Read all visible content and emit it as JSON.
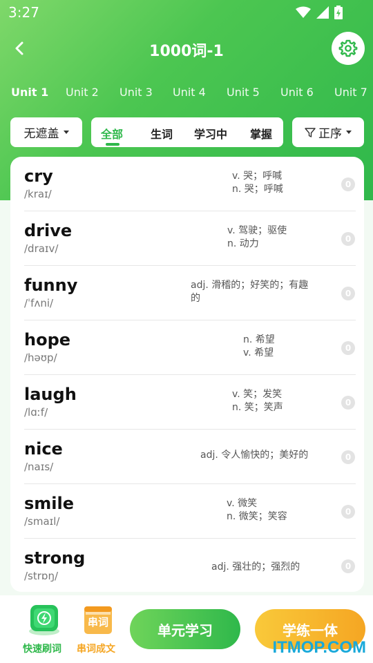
{
  "status": {
    "time": "3:27"
  },
  "header": {
    "title": "1000词-1"
  },
  "units": [
    "Unit 1",
    "Unit 2",
    "Unit 3",
    "Unit 4",
    "Unit 5",
    "Unit 6",
    "Unit 7"
  ],
  "filters": {
    "cover_label": "无遮盖",
    "tabs": [
      "全部",
      "生词",
      "学习中",
      "掌握"
    ],
    "order_label": "正序"
  },
  "words": [
    {
      "word": "cry",
      "phonetic": "/kraɪ/",
      "meaning_1": "v. 哭；呼喊",
      "meaning_2": "n. 哭；呼喊",
      "count": "0"
    },
    {
      "word": "drive",
      "phonetic": "/draɪv/",
      "meaning_1": "v. 驾驶；驱使",
      "meaning_2": "n. 动力",
      "count": "0"
    },
    {
      "word": "funny",
      "phonetic": "/ˈfʌni/",
      "meaning_1": "adj. 滑稽的；好笑的；有趣",
      "meaning_2": "的",
      "count": "0"
    },
    {
      "word": "hope",
      "phonetic": "/həʊp/",
      "meaning_1": "n. 希望",
      "meaning_2": "v. 希望",
      "count": "0"
    },
    {
      "word": "laugh",
      "phonetic": "/lɑːf/",
      "meaning_1": "v. 笑；发笑",
      "meaning_2": "n. 笑；笑声",
      "count": "0"
    },
    {
      "word": "nice",
      "phonetic": "/naɪs/",
      "meaning_1": "adj. 令人愉快的；美好的",
      "meaning_2": "",
      "count": "0"
    },
    {
      "word": "smile",
      "phonetic": "/smaɪl/",
      "meaning_1": "v. 微笑",
      "meaning_2": "n. 微笑；笑容",
      "count": "0"
    },
    {
      "word": "strong",
      "phonetic": "/strɒŋ/",
      "meaning_1": "adj. 强壮的；强烈的",
      "meaning_2": "",
      "count": "0"
    }
  ],
  "bottom": {
    "quick_label": "快速刷词",
    "chain_icon_text": "串词",
    "chain_label": "串词成文",
    "unit_study_label": "单元学习",
    "practice_label": "学练一体"
  },
  "watermark": "ITMOP.COM",
  "colors": {
    "primary": "#2fb84b",
    "orange": "#f5a623",
    "text": "#111111"
  }
}
